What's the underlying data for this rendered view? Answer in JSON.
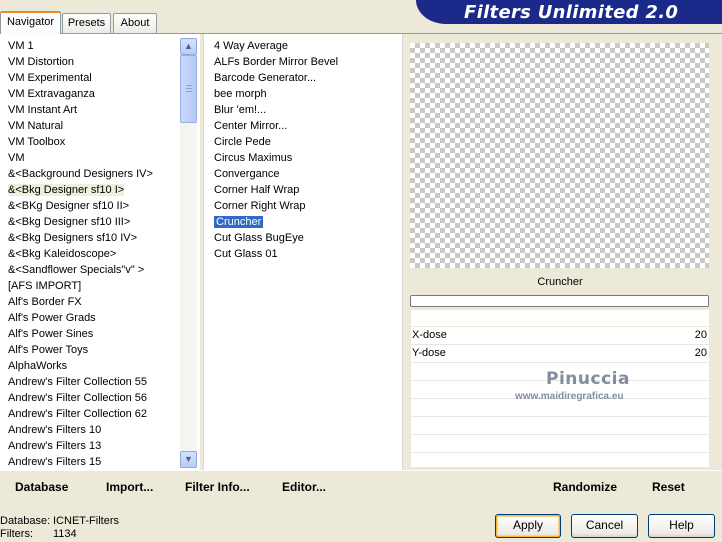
{
  "tabs": [
    "Navigator",
    "Presets",
    "About"
  ],
  "banner_title": "Filters Unlimited 2.0",
  "categories": [
    "VM 1",
    "VM Distortion",
    "VM Experimental",
    "VM Extravaganza",
    "VM Instant Art",
    "VM Natural",
    "VM Toolbox",
    "VM",
    "&<Background Designers IV>",
    "&<Bkg Designer sf10 I>",
    "&<BKg Designer sf10 II>",
    "&<Bkg Designer sf10 III>",
    "&<Bkg Designers sf10 IV>",
    "&<Bkg Kaleidoscope>",
    "&<Sandflower Specials\"v\" >",
    "[AFS IMPORT]",
    "Alf's Border FX",
    "Alf's Power Grads",
    "Alf's Power Sines",
    "Alf's Power Toys",
    "AlphaWorks",
    "Andrew's Filter Collection 55",
    "Andrew's Filter Collection 56",
    "Andrew's Filter Collection 62",
    "Andrew's Filters 10",
    "Andrew's Filters 13",
    "Andrew's Filters 15"
  ],
  "highlighted_category": "&<Bkg Designer sf10 I>",
  "filters": [
    "4 Way Average",
    "ALFs Border Mirror Bevel",
    "Barcode Generator...",
    "bee morph",
    "Blur 'em!...",
    "Center Mirror...",
    "Circle Pede",
    "Circus Maximus",
    "Convergance",
    "Corner Half Wrap",
    "Corner Right Wrap",
    "Cruncher",
    "Cut Glass  BugEye",
    "Cut Glass 01"
  ],
  "selected_filter": "Cruncher",
  "preview": {
    "filter_name": "Cruncher",
    "progress": 0
  },
  "params": [
    {
      "label": "X-dose",
      "value": "20"
    },
    {
      "label": "Y-dose",
      "value": "20"
    }
  ],
  "watermark": {
    "name": "Pinuccia",
    "url": "www.maidiregrafica.eu"
  },
  "links": {
    "database": "Database",
    "import": "Import...",
    "filter_info": "Filter Info...",
    "editor": "Editor...",
    "randomize": "Randomize",
    "reset": "Reset"
  },
  "status": {
    "database_label": "Database:",
    "database_value": "ICNET-Filters",
    "filters_label": "Filters:",
    "filters_value": "1134"
  },
  "buttons": {
    "apply": "Apply",
    "cancel": "Cancel",
    "help": "Help"
  },
  "colors": {
    "banner": "#1b2a8a",
    "selection": "#316ac5",
    "tab_accent": "#e68b2c"
  }
}
